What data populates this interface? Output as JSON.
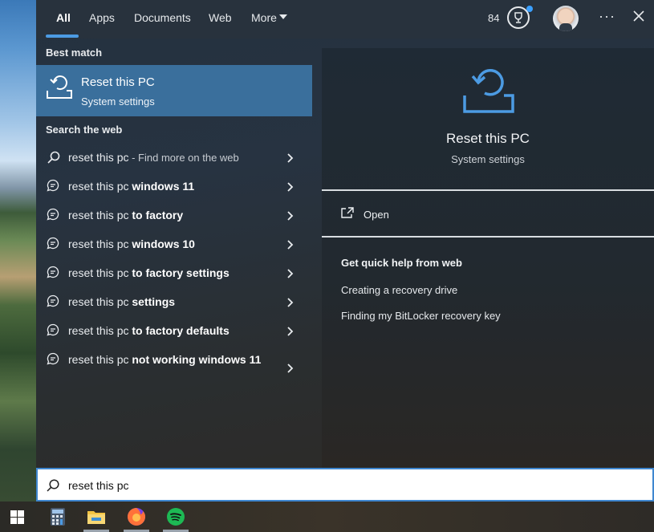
{
  "tabs": {
    "all": "All",
    "apps": "Apps",
    "documents": "Documents",
    "web": "Web",
    "more": "More"
  },
  "header": {
    "points": "84",
    "icons": [
      "trophy-icon",
      "avatar",
      "more-options-icon",
      "close-icon"
    ]
  },
  "best_match": {
    "label": "Best match",
    "title": "Reset this PC",
    "subtitle": "System settings"
  },
  "search_web": {
    "label": "Search the web",
    "items": [
      {
        "prefix": "reset this pc",
        "suffix": "",
        "hint": " - Find more on the web",
        "icon": "search-icon"
      },
      {
        "prefix": "reset this pc",
        "suffix": " windows 11",
        "hint": "",
        "icon": "chat-search-icon"
      },
      {
        "prefix": "reset this pc",
        "suffix": " to factory",
        "hint": "",
        "icon": "chat-search-icon"
      },
      {
        "prefix": "reset this pc",
        "suffix": " windows 10",
        "hint": "",
        "icon": "chat-search-icon"
      },
      {
        "prefix": "reset this pc",
        "suffix": " to factory settings",
        "hint": "",
        "icon": "chat-search-icon"
      },
      {
        "prefix": "reset this pc",
        "suffix": " settings",
        "hint": "",
        "icon": "chat-search-icon"
      },
      {
        "prefix": "reset this pc",
        "suffix": " to factory defaults",
        "hint": "",
        "icon": "chat-search-icon"
      },
      {
        "prefix": "reset this pc",
        "suffix": " not working windows 11",
        "hint": "",
        "icon": "chat-search-icon"
      }
    ]
  },
  "preview": {
    "title": "Reset this PC",
    "subtitle": "System settings",
    "open_label": "Open",
    "quick_help_label": "Get quick help from web",
    "links": [
      "Creating a recovery drive",
      "Finding my BitLocker recovery key"
    ]
  },
  "search": {
    "value": "reset this pc"
  },
  "taskbar": {
    "items": [
      "windows-start-icon",
      "calculator-icon",
      "file-explorer-icon",
      "firefox-icon",
      "spotify-icon"
    ]
  },
  "colors": {
    "accent": "#4c9be3",
    "selected": "#3a6f9c",
    "spotify": "#1db954",
    "firefox": "#ff7139"
  }
}
